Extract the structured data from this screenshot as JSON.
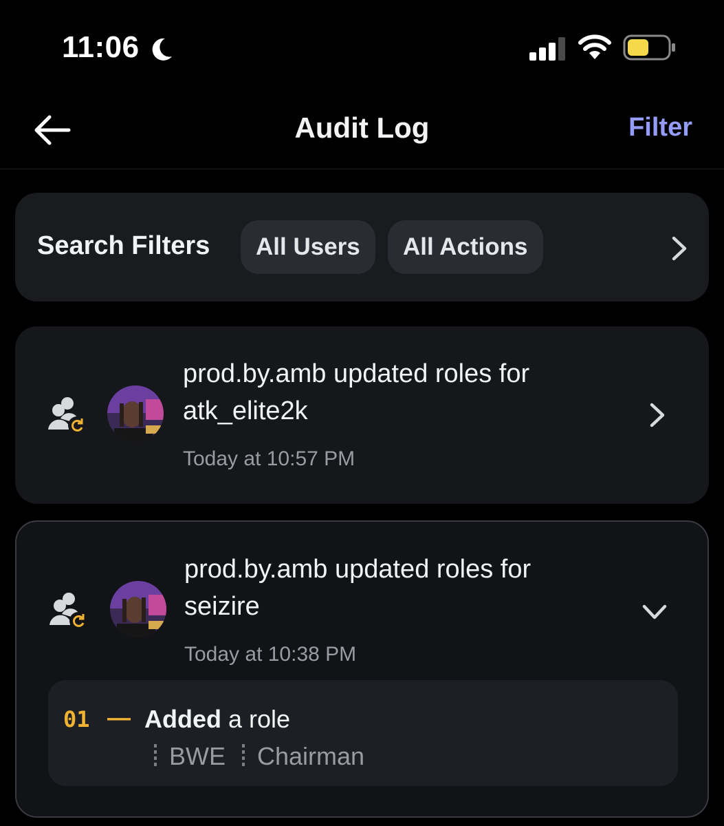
{
  "status_bar": {
    "time": "11:06",
    "icons": [
      "moon-icon",
      "cellular-signal-icon",
      "wifi-icon",
      "battery-icon"
    ]
  },
  "nav": {
    "title": "Audit Log",
    "back_icon": "arrow-left-icon",
    "filter_label": "Filter"
  },
  "filters": {
    "label": "Search Filters",
    "chips": [
      "All Users",
      "All Actions"
    ],
    "more_icon": "chevron-right-icon"
  },
  "entries": [
    {
      "actor": "prod.by.amb",
      "action": "updated roles for",
      "target": "atk_elite2k",
      "text_line1": "prod.by.amb updated roles for",
      "text_line2": "atk_elite2k",
      "time": "Today at 10:57 PM",
      "icon": "member-role-update-icon",
      "expanded": false
    },
    {
      "actor": "prod.by.amb",
      "action": "updated roles for",
      "target": "seizire",
      "text_line1": "prod.by.amb updated roles for",
      "text_line2": "seizire",
      "time": "Today at 10:38 PM",
      "icon": "member-role-update-icon",
      "expanded": true,
      "changes": [
        {
          "index": "01",
          "dash": "—",
          "verb": "Added",
          "rest": "a role",
          "roles": [
            "BWE",
            "Chairman"
          ]
        }
      ]
    }
  ],
  "colors": {
    "background": "#000000",
    "card": "#1a1b1f",
    "accent": "#949cf7",
    "change_index": "#f0b232",
    "muted_text": "#9a9ca4"
  }
}
